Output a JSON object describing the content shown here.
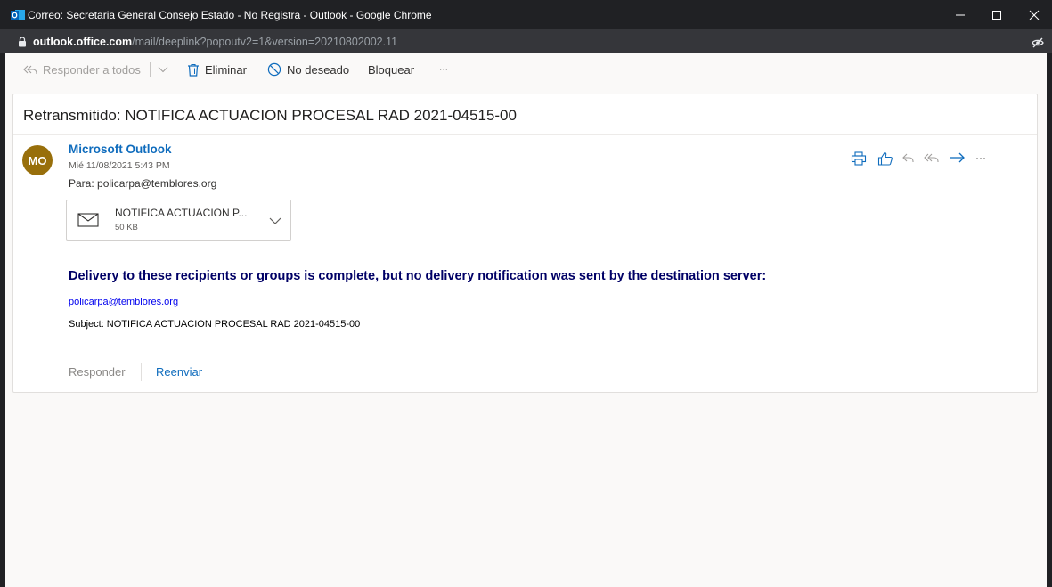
{
  "window": {
    "title": "Correo: Secretaria General Consejo Estado - No Registra - Outlook - Google Chrome",
    "url_host": "outlook.office.com",
    "url_path": "/mail/deeplink?popoutv2=1&version=20210802002.11",
    "min_symbol": "—",
    "max_symbol": "☐",
    "close_symbol": "✕"
  },
  "toolbar": {
    "reply_all_label": "Responder a todos",
    "delete_label": "Eliminar",
    "junk_label": "No deseado",
    "block_label": "Bloquear",
    "more_label": "···"
  },
  "message": {
    "subject": "Retransmitido: NOTIFICA ACTUACION PROCESAL RAD 2021-04515-00",
    "avatar_initials": "MO",
    "sender": "Microsoft Outlook",
    "date": "Mié 11/08/2021 5:43 PM",
    "to": "Para:  policarpa@temblores.org",
    "more_label": "···"
  },
  "attachment": {
    "name": "NOTIFICA ACTUACION P...",
    "size": "50 KB"
  },
  "body": {
    "delivery_text": "Delivery to these recipients or groups is complete, but no delivery notification was sent by the destination server:",
    "recipient_link": "policarpa@temblores.org",
    "subject_line": "Subject: NOTIFICA ACTUACION PROCESAL RAD 2021-04515-00"
  },
  "footer": {
    "reply_label": "Responder",
    "forward_label": "Reenviar"
  },
  "colors": {
    "chrome_bar": "#202124",
    "url_bar": "#35363a",
    "avatar": "#986f0b",
    "link_blue": "#0f6cbd",
    "delivery_text": "#000066"
  }
}
